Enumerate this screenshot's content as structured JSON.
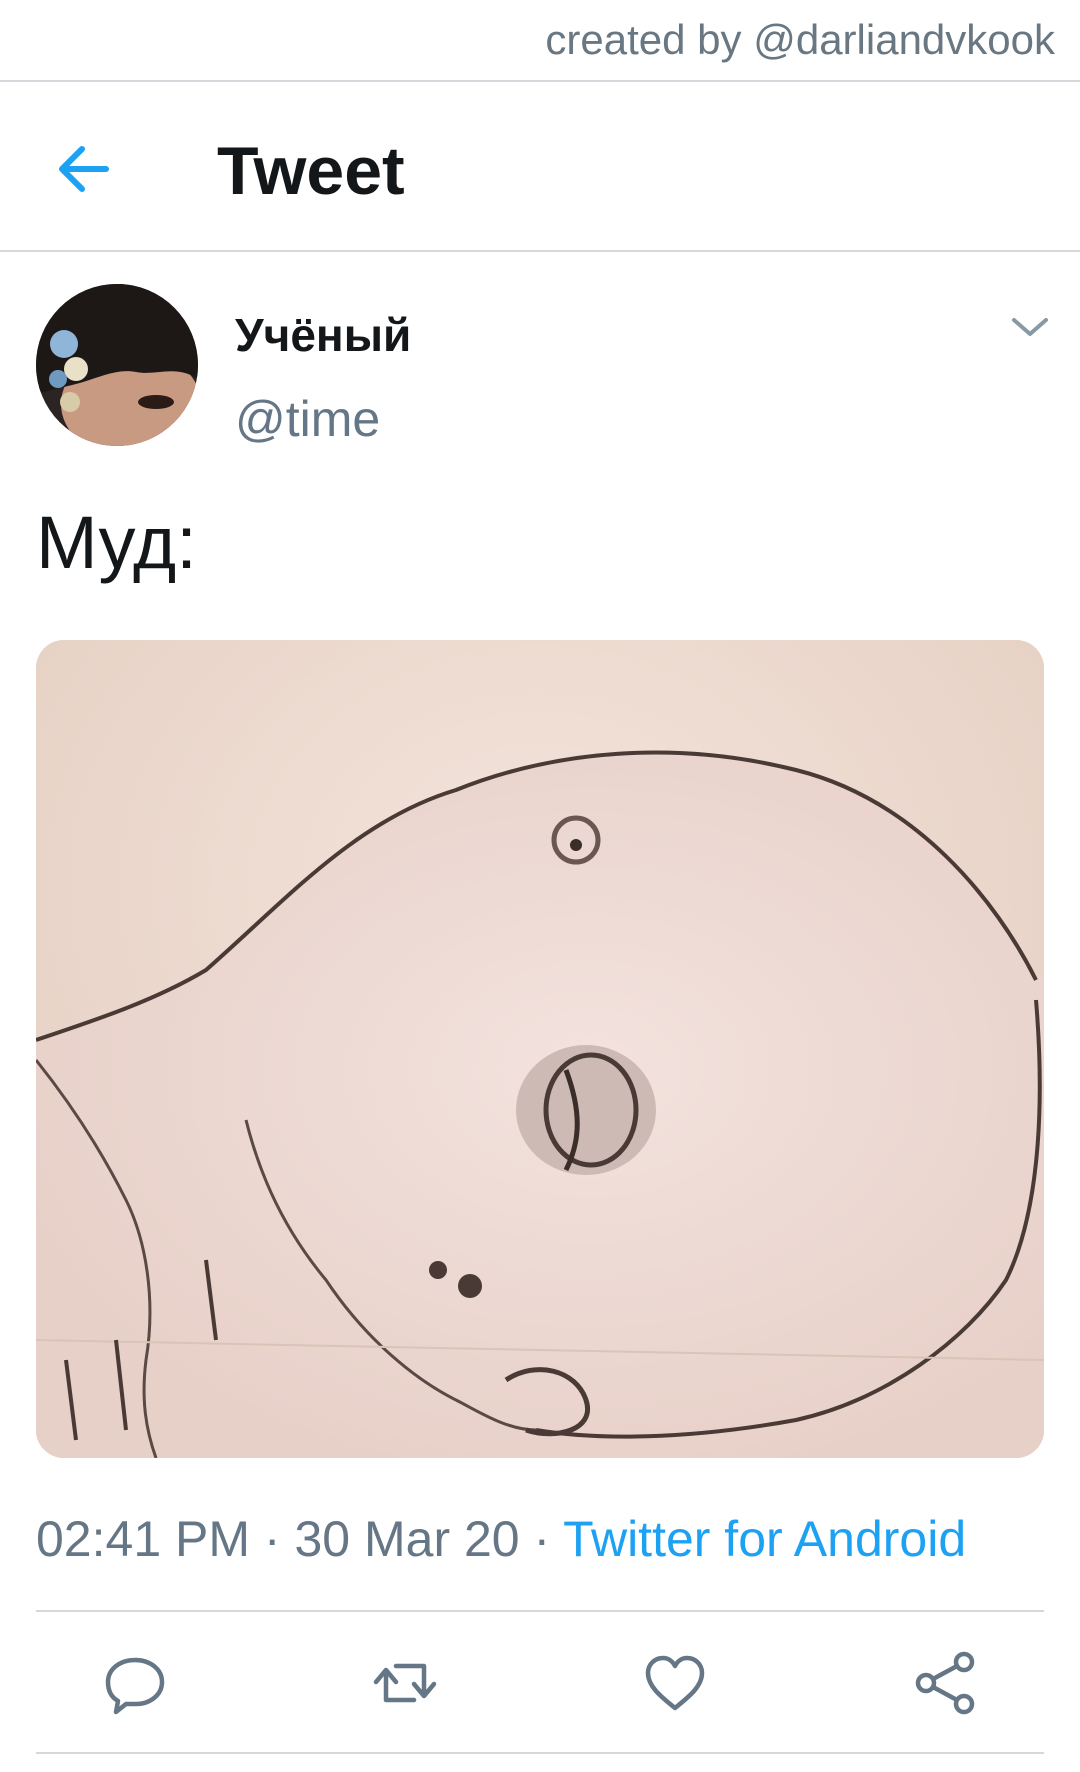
{
  "watermark": {
    "text": "created by @darliandvkook"
  },
  "header": {
    "title": "Tweet",
    "back_icon": "arrow-left-icon"
  },
  "tweet": {
    "author": {
      "display_name": "Учёный",
      "handle": "@time"
    },
    "text": "Муд:",
    "meta": {
      "time": "02:41 PM",
      "date": "30 Mar 20",
      "separator": "·",
      "source": "Twitter for Android"
    },
    "actions": [
      "reply-icon",
      "retweet-icon",
      "like-icon",
      "share-icon"
    ]
  },
  "colors": {
    "accent": "#1da1f2",
    "text_primary": "#14171a",
    "text_secondary": "#657786",
    "divider": "#d4d8dc"
  }
}
